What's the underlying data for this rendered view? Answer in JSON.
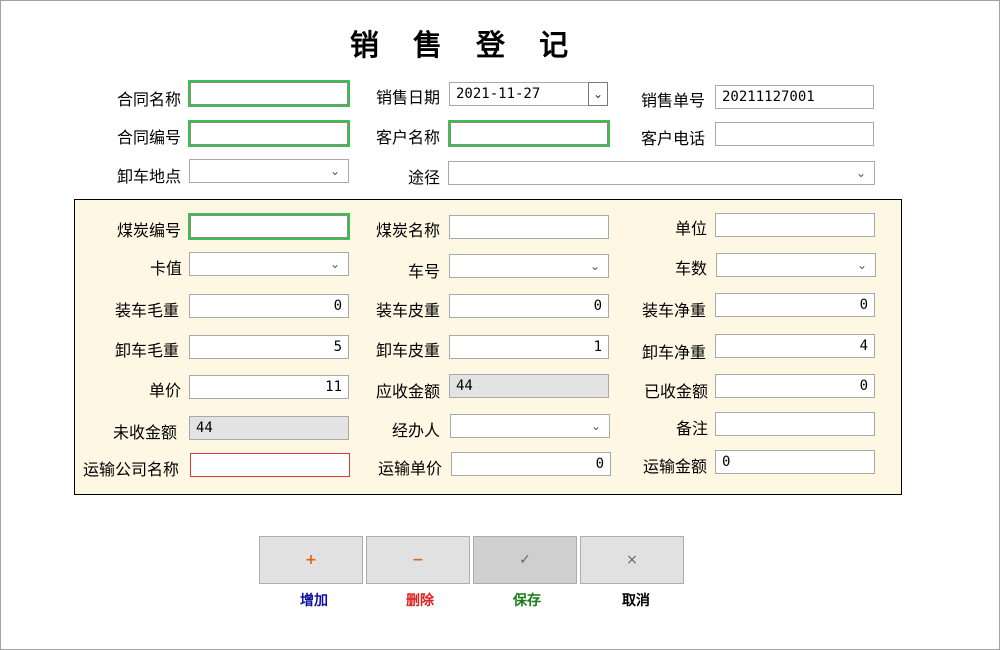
{
  "title": "销 售 登 记",
  "labels": {
    "contract_name": "合同名称",
    "sale_date": "销售日期",
    "sale_no": "销售单号",
    "contract_no": "合同编号",
    "customer_name": "客户名称",
    "customer_phone": "客户电话",
    "unload_place": "卸车地点",
    "route": "途径",
    "coal_no": "煤炭编号",
    "coal_name": "煤炭名称",
    "unit": "单位",
    "card_value": "卡值",
    "truck_no": "车号",
    "truck_count": "车数",
    "load_gross": "装车毛重",
    "load_tare": "装车皮重",
    "load_net": "装车净重",
    "unload_gross": "卸车毛重",
    "unload_tare": "卸车皮重",
    "unload_net": "卸车净重",
    "unit_price": "单价",
    "receivable": "应收金额",
    "received": "已收金额",
    "unreceived": "未收金额",
    "handler": "经办人",
    "remark": "备注",
    "transport_company": "运输公司名称",
    "transport_unit_price": "运输单价",
    "transport_amount": "运输金额"
  },
  "values": {
    "sale_date": "2021-11-27",
    "sale_no": "20211127001",
    "load_gross": "0",
    "load_tare": "0",
    "load_net": "0",
    "unload_gross": "5",
    "unload_tare": "1",
    "unload_net": "4",
    "unit_price": "11",
    "receivable": "44",
    "received": "0",
    "unreceived": "44",
    "transport_unit_price": "0",
    "transport_amount": "0"
  },
  "icons": {
    "add": "+",
    "delete": "−",
    "save": "✓",
    "cancel": "×",
    "dropdown": "⌄"
  },
  "buttons": {
    "add_label": "增加",
    "delete_label": "删除",
    "save_label": "保存",
    "cancel_label": "取消"
  },
  "colors": {
    "panel_bg": "#fdf7e3",
    "focus_border": "#3dbf4f",
    "invalid_border": "#d63a3a",
    "add_label": "#1010a0",
    "delete_label": "#e02020",
    "save_label": "#1a7a1a",
    "cancel_label": "#000000",
    "add_icon": "#e06010",
    "delete_icon": "#e06010"
  }
}
